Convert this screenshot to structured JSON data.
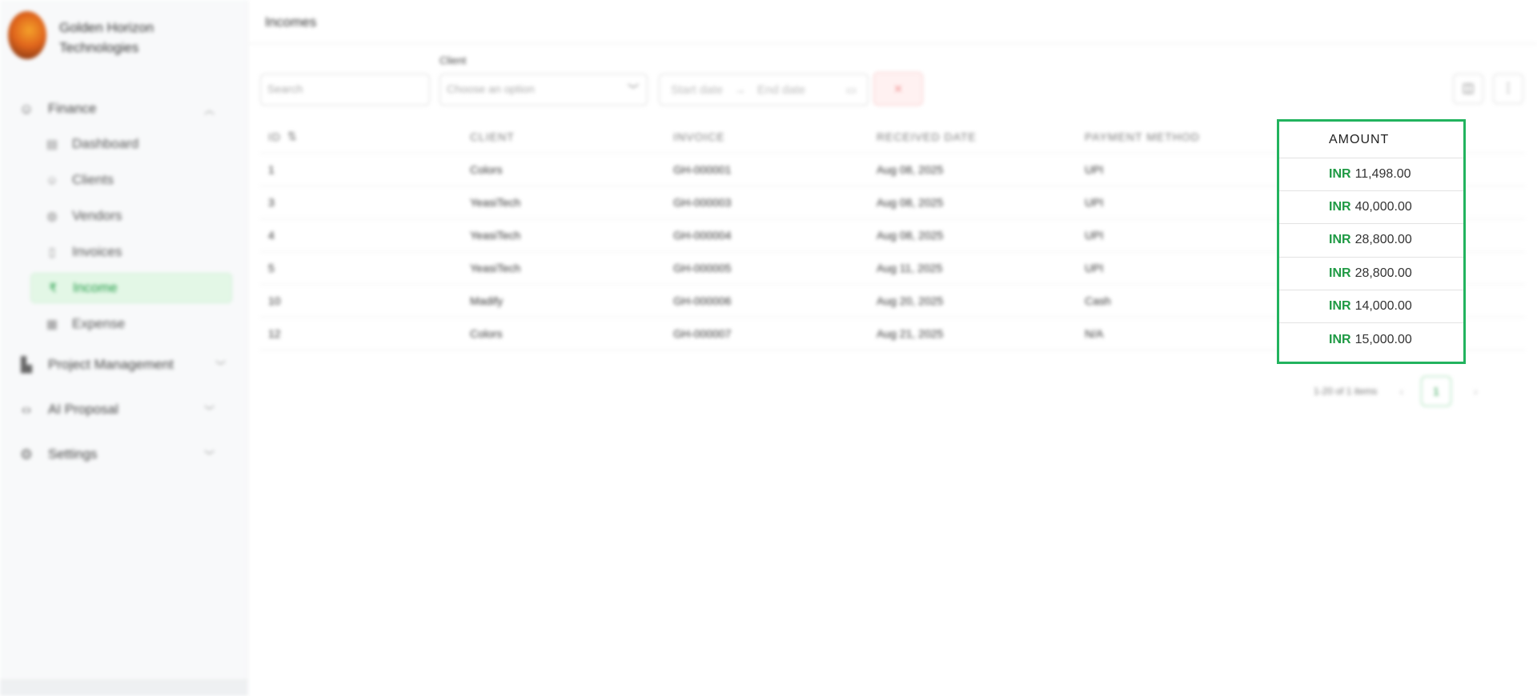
{
  "sidebar": {
    "brand_name": "Golden Horizon Technologies",
    "groups": [
      {
        "label": "Finance",
        "icon": "users-icon",
        "expanded": true
      },
      {
        "label": "Project Management",
        "icon": "building-icon"
      },
      {
        "label": "AI Proposal",
        "icon": "code-icon"
      },
      {
        "label": "Settings",
        "icon": "gear-icon"
      }
    ],
    "finance_items": [
      {
        "label": "Dashboard",
        "icon": "dashboard-icon"
      },
      {
        "label": "Clients",
        "icon": "user-icon"
      },
      {
        "label": "Vendors",
        "icon": "globe-icon"
      },
      {
        "label": "Invoices",
        "icon": "document-icon"
      },
      {
        "label": "Income",
        "icon": "rupee-icon",
        "active": true
      },
      {
        "label": "Expense",
        "icon": "grid-icon"
      }
    ]
  },
  "header": {
    "title": "Incomes"
  },
  "filters": {
    "search_placeholder": "Search",
    "client_label": "Client",
    "client_placeholder": "Choose an option",
    "start_date_placeholder": "Start date",
    "end_date_placeholder": "End date",
    "clear_icon": "×"
  },
  "table": {
    "columns": [
      "ID",
      "CLIENT",
      "INVOICE",
      "RECEIVED DATE",
      "PAYMENT METHOD",
      "AMOUNT"
    ],
    "rows": [
      {
        "id": "1",
        "client": "Colors",
        "invoice": "GH-000001",
        "date": "Aug 08, 2025",
        "method": "UPI",
        "currency": "INR",
        "amount": "11,498.00"
      },
      {
        "id": "3",
        "client": "YeasiTech",
        "invoice": "GH-000003",
        "date": "Aug 08, 2025",
        "method": "UPI",
        "currency": "INR",
        "amount": "40,000.00"
      },
      {
        "id": "4",
        "client": "YeasiTech",
        "invoice": "GH-000004",
        "date": "Aug 08, 2025",
        "method": "UPI",
        "currency": "INR",
        "amount": "28,800.00"
      },
      {
        "id": "5",
        "client": "YeasiTech",
        "invoice": "GH-000005",
        "date": "Aug 11, 2025",
        "method": "UPI",
        "currency": "INR",
        "amount": "28,800.00"
      },
      {
        "id": "10",
        "client": "Madify",
        "invoice": "GH-000006",
        "date": "Aug 20, 2025",
        "method": "Cash",
        "currency": "INR",
        "amount": "14,000.00"
      },
      {
        "id": "12",
        "client": "Colors",
        "invoice": "GH-000007",
        "date": "Aug 21, 2025",
        "method": "N/A",
        "currency": "INR",
        "amount": "15,000.00"
      }
    ]
  },
  "pagination": {
    "summary": "1-20 of 1 items",
    "current_page": "1"
  },
  "colors": {
    "accent_green": "#1f9a44",
    "highlight_border": "#22b35e",
    "link_blue": "#4d7cf0"
  }
}
